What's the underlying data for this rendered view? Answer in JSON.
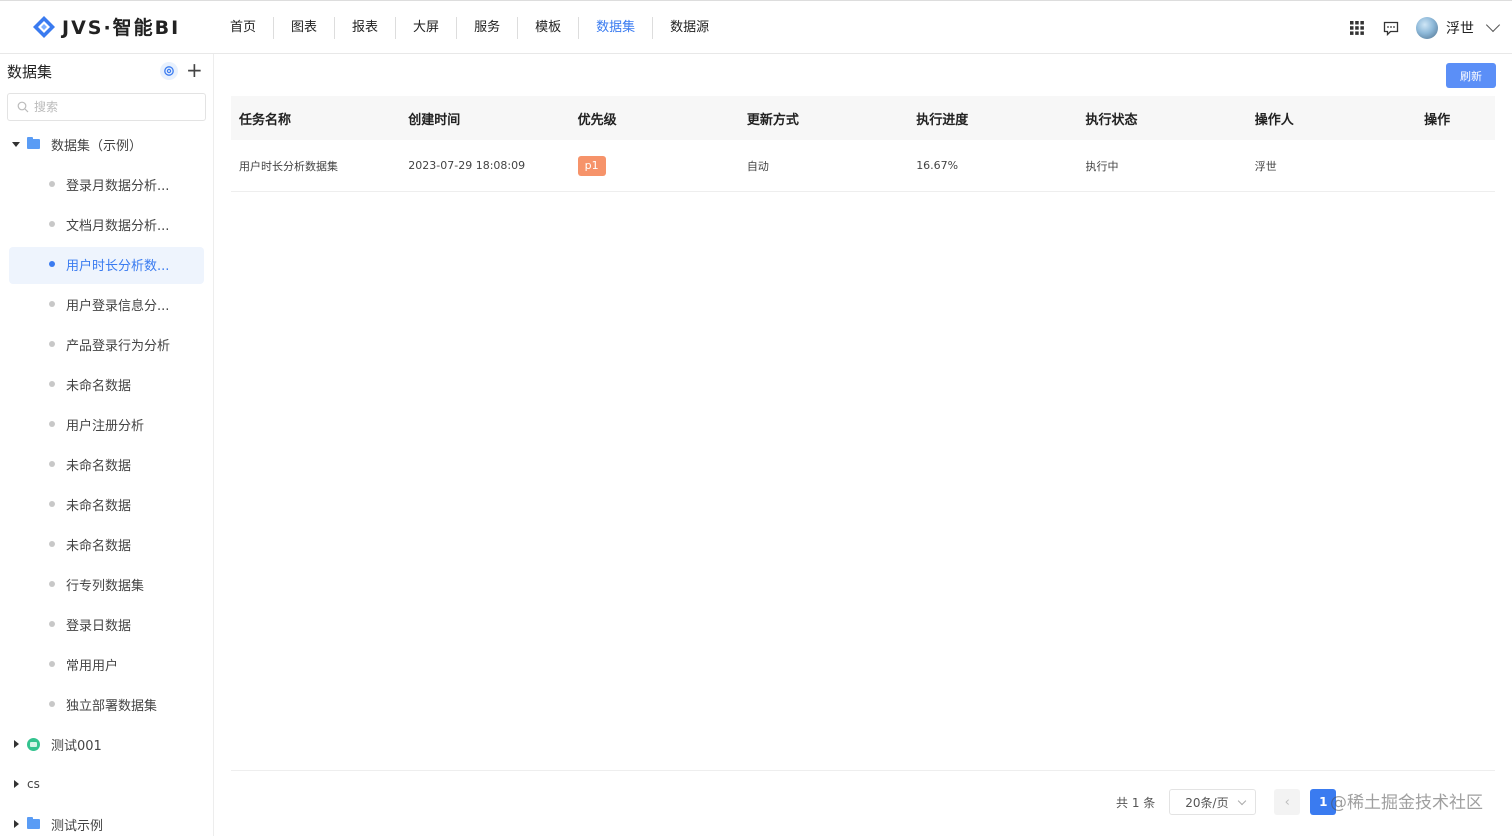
{
  "header": {
    "brand": "JVS·智能BI",
    "nav": [
      "首页",
      "图表",
      "报表",
      "大屏",
      "服务",
      "模板",
      "数据集",
      "数据源"
    ],
    "active_nav": "数据集",
    "user_name": "浮世",
    "accent_color": "#3a7bf0"
  },
  "sidebar": {
    "title": "数据集",
    "search_placeholder": "搜索",
    "root_label": "数据集（示例）",
    "items": [
      "登录月数据分析...",
      "文档月数据分析...",
      "用户时长分析数...",
      "用户登录信息分...",
      "产品登录行为分析",
      "未命名数据",
      "用户注册分析",
      "未命名数据",
      "未命名数据",
      "未命名数据",
      "行专列数据集",
      "登录日数据",
      "常用用户",
      "独立部署数据集"
    ],
    "selected_index": 2,
    "groups": [
      "测试001",
      "cs",
      "测试示例"
    ]
  },
  "toolbar": {
    "refresh_label": "刷新"
  },
  "table": {
    "columns": [
      "任务名称",
      "创建时间",
      "优先级",
      "更新方式",
      "执行进度",
      "执行状态",
      "操作人",
      "操作"
    ],
    "rows": [
      {
        "name": "用户时长分析数据集",
        "created": "2023-07-29 18:08:09",
        "priority": "p1",
        "update_mode": "自动",
        "progress": "16.67%",
        "status": "执行中",
        "operator": "浮世",
        "action": ""
      }
    ]
  },
  "pagination": {
    "total": "共 1 条",
    "page_size": "20条/页",
    "prev": "‹",
    "current": "1"
  },
  "watermark": "@稀土掘金技术社区"
}
